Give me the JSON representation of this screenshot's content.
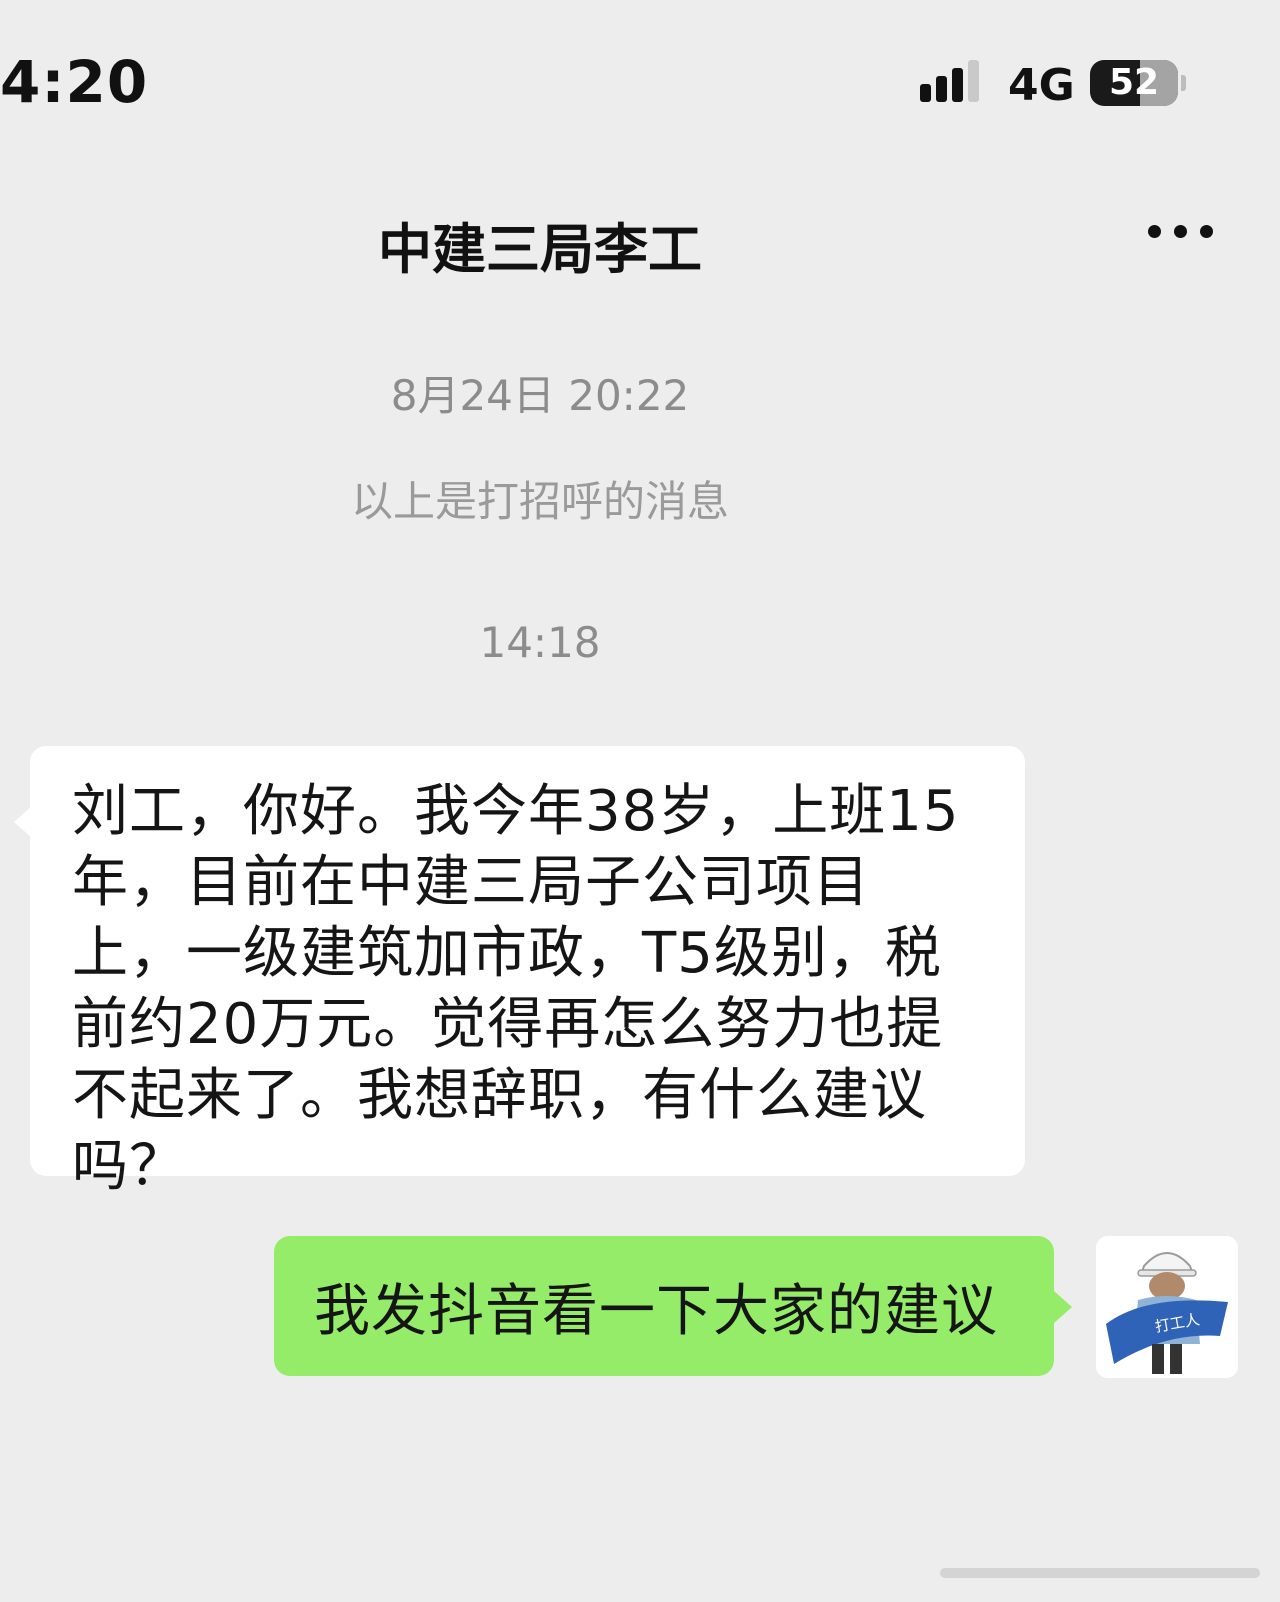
{
  "status_bar": {
    "time": "4:20",
    "network": "4G",
    "battery": "52",
    "icons": [
      "signal-icon",
      "battery-icon"
    ]
  },
  "nav": {
    "title": "中建三局李工",
    "more_icon": "more-dots-icon"
  },
  "chat": {
    "date_stamp": "8月24日 20:22",
    "greeting_hint": "以上是打招呼的消息",
    "time_stamp": "14:18",
    "messages": [
      {
        "side": "incoming",
        "text": "刘工，你好。我今年38岁，上班15年，目前在中建三局子公司项目上，一级建筑加市政，T5级别，税前约20万元。觉得再怎么努力也提不起来了。我想辞职，有什么建议吗？"
      },
      {
        "side": "outgoing",
        "text": "我发抖音看一下大家的建议"
      }
    ],
    "avatar": {
      "banner_text": "打工人",
      "icon": "worker-avatar-icon"
    }
  },
  "colors": {
    "background": "#ededed",
    "incoming_bubble": "#ffffff",
    "outgoing_bubble": "#95ec69",
    "system_text": "#8c8c8c"
  }
}
